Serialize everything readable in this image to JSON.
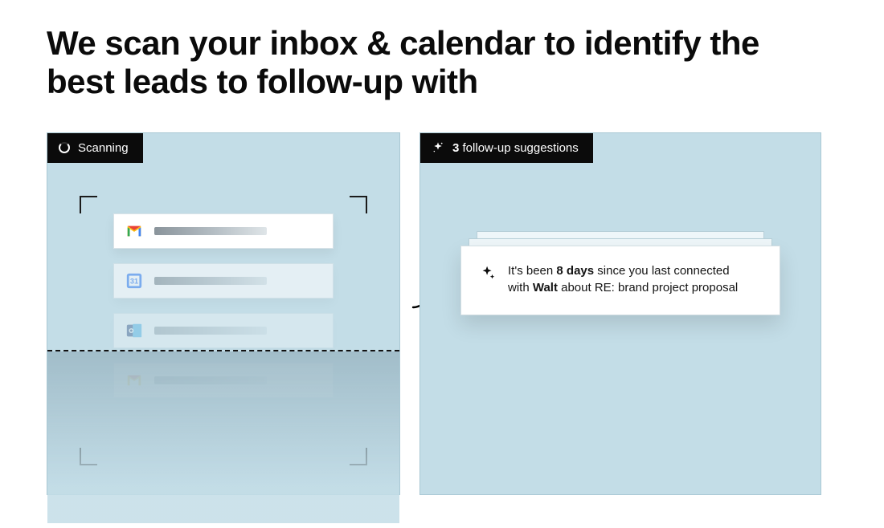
{
  "headline": "We scan your inbox & calendar to identify the best leads to follow-up with",
  "left": {
    "badge": "Scanning",
    "rows": [
      {
        "icon": "gmail"
      },
      {
        "icon": "gcal"
      },
      {
        "icon": "outlook"
      },
      {
        "icon": "gmail"
      }
    ]
  },
  "right": {
    "badge_count": "3",
    "badge_label": "follow-up suggestions",
    "suggestion": {
      "line1_prefix": "It's been ",
      "line1_bold": "8 days",
      "line1_suffix": " since you last connected",
      "line2_prefix": "with ",
      "line2_bold": "Walt",
      "line2_suffix": " about RE: brand project proposal"
    }
  }
}
